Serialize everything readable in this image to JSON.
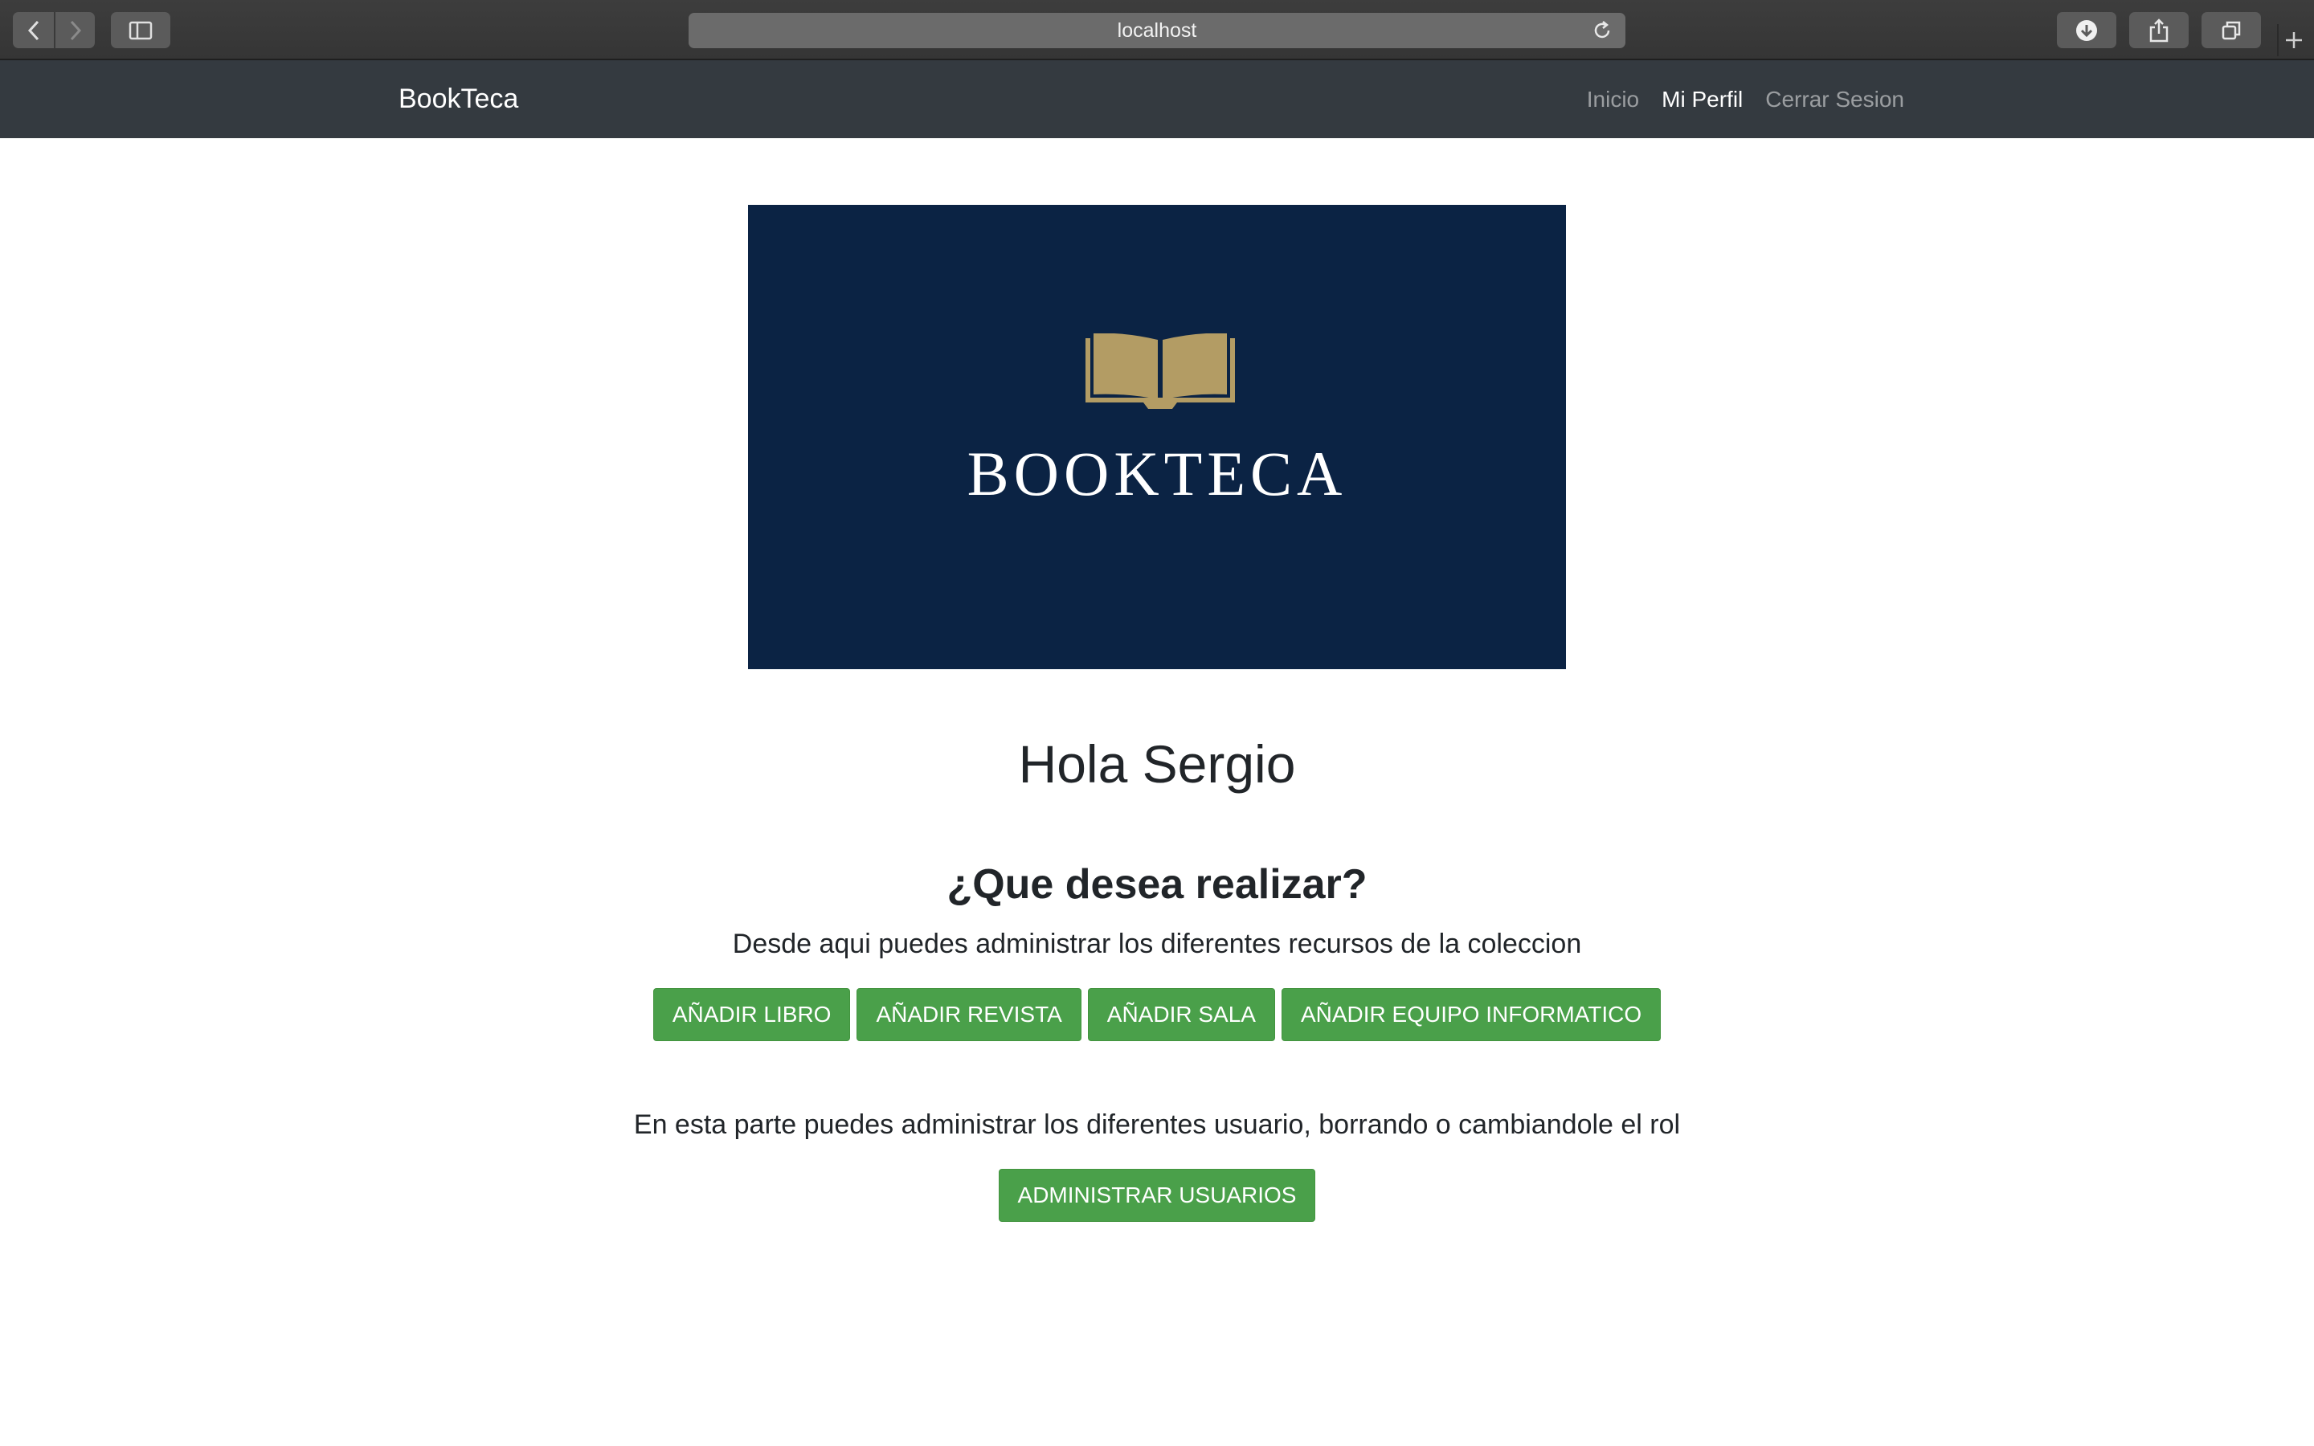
{
  "browser": {
    "url": "localhost"
  },
  "navbar": {
    "brand": "BookTeca",
    "links": [
      {
        "label": "Inicio",
        "active": false
      },
      {
        "label": "Mi Perfil",
        "active": true
      },
      {
        "label": "Cerrar Sesion",
        "active": false
      }
    ]
  },
  "logo": {
    "text": "BOOKTECA",
    "colors": {
      "background": "#0b2344",
      "book": "#b39c64",
      "text": "#ffffff"
    }
  },
  "main": {
    "greeting": "Hola Sergio",
    "question": "¿Que desea realizar?",
    "description": "Desde aqui puedes administrar los diferentes recursos de la coleccion",
    "resource_buttons": [
      "AÑADIR LIBRO",
      "AÑADIR REVISTA",
      "AÑADIR SALA",
      "AÑADIR EQUIPO INFORMATICO"
    ],
    "users_description": "En esta parte puedes administrar los diferentes usuario, borrando o cambiandole el rol",
    "users_button": "ADMINISTRAR USUARIOS"
  },
  "colors": {
    "navbar": "#343a40",
    "button": "#4aa04a"
  }
}
